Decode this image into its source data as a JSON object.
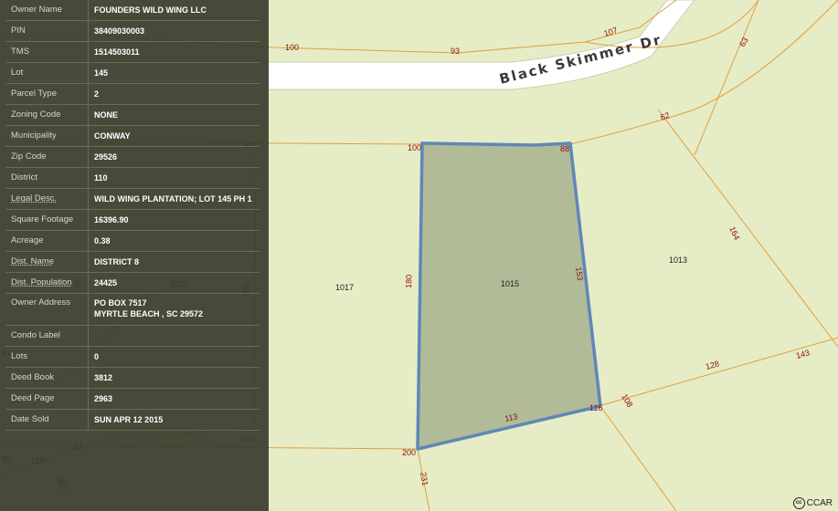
{
  "map": {
    "street_name": "Black Skimmer Dr",
    "parcel_ids": [
      "1015",
      "1017",
      "1019",
      "1013"
    ],
    "lot_dimensions": [
      "100",
      "93",
      "107",
      "63",
      "62",
      "100",
      "88",
      "84",
      "164",
      "180",
      "153",
      "143",
      "128",
      "108",
      "116",
      "113",
      "200",
      "231",
      "160",
      "100",
      "24",
      "116",
      "323",
      "170",
      "41",
      "20"
    ],
    "colors": {
      "background": "#e6ecc6",
      "road": "#ffffff",
      "lot_line": "#e0a040",
      "selected_fill": "#b2bb98",
      "selected_outline": "#5f87b8",
      "dimension_text": "#8a1010"
    }
  },
  "info": {
    "rows": [
      {
        "label": "Owner Name",
        "value": "FOUNDERS WILD WING LLC"
      },
      {
        "label": "PIN",
        "value": "38409030003"
      },
      {
        "label": "TMS",
        "value": "1514503011"
      },
      {
        "label": "Lot",
        "value": "145"
      },
      {
        "label": "Parcel Type",
        "value": "2"
      },
      {
        "label": "Zoning Code",
        "value": "NONE"
      },
      {
        "label": "Municipality",
        "value": "CONWAY"
      },
      {
        "label": "Zip Code",
        "value": "29526"
      },
      {
        "label": "District",
        "value": "110"
      },
      {
        "label": "Legal Desc.",
        "value": "WILD WING PLANTATION; LOT 145 PH 1"
      },
      {
        "label": "Square Footage",
        "value": "16396.90"
      },
      {
        "label": "Acreage",
        "value": "0.38"
      },
      {
        "label": "Dist. Name",
        "value": "DISTRICT 8"
      },
      {
        "label": "Dist. Population",
        "value": "24425"
      }
    ],
    "owner_address": {
      "label": "Owner Address",
      "line1": "PO BOX 7517",
      "line2": "MYRTLE BEACH , SC 29572"
    },
    "rows2": [
      {
        "label": "Condo Label",
        "value": ""
      },
      {
        "label": "Lots",
        "value": "0"
      },
      {
        "label": "Deed Book",
        "value": "3812"
      },
      {
        "label": "Deed Page",
        "value": "2963"
      },
      {
        "label": "Date Sold",
        "value": "SUN APR 12 2015"
      }
    ]
  },
  "copyright": "CCAR",
  "cc_badge": "cc"
}
